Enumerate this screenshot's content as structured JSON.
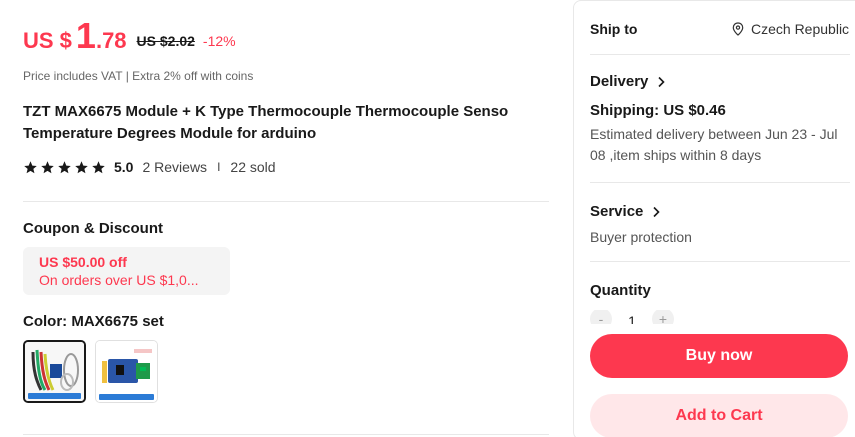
{
  "price": {
    "currency": "US $",
    "integer": "1",
    "decimal": ".78",
    "original": "US $2.02",
    "discount": "-12%"
  },
  "vat_note": "Price includes VAT | Extra 2% off with coins",
  "product": {
    "title": "TZT MAX6675 Module + K Type Thermocouple Thermocouple Senso Temperature Degrees Module for arduino"
  },
  "rating": {
    "score": "5.0",
    "reviews": "2 Reviews",
    "separator": "I",
    "sold": "22 sold",
    "stars": 5
  },
  "coupon": {
    "title": "Coupon & Discount",
    "line1": "US $50.00 off",
    "line2": "On orders over US $1,0..."
  },
  "color": {
    "title": "Color: MAX6675 set",
    "options": [
      {
        "label": "MAX6675 Set",
        "selected": true
      },
      {
        "label": "MAX6675 Module",
        "selected": false
      }
    ]
  },
  "shipping": {
    "ship_to_label": "Ship to",
    "country": "Czech Republic",
    "delivery_label": "Delivery",
    "shipping_price": "Shipping: US $0.46",
    "estimate": "Estimated delivery between Jun 23 - Jul 08 ,item ships within 8 days",
    "service_label": "Service",
    "service_value": "Buyer protection"
  },
  "quantity": {
    "label": "Quantity",
    "value": "1",
    "minus": "-",
    "plus": "+"
  },
  "actions": {
    "buy_now": "Buy now",
    "add_to_cart": "Add to Cart"
  },
  "colors": {
    "accent": "#fd384f",
    "accent_light": "#ffe7e9",
    "text": "#191919"
  }
}
